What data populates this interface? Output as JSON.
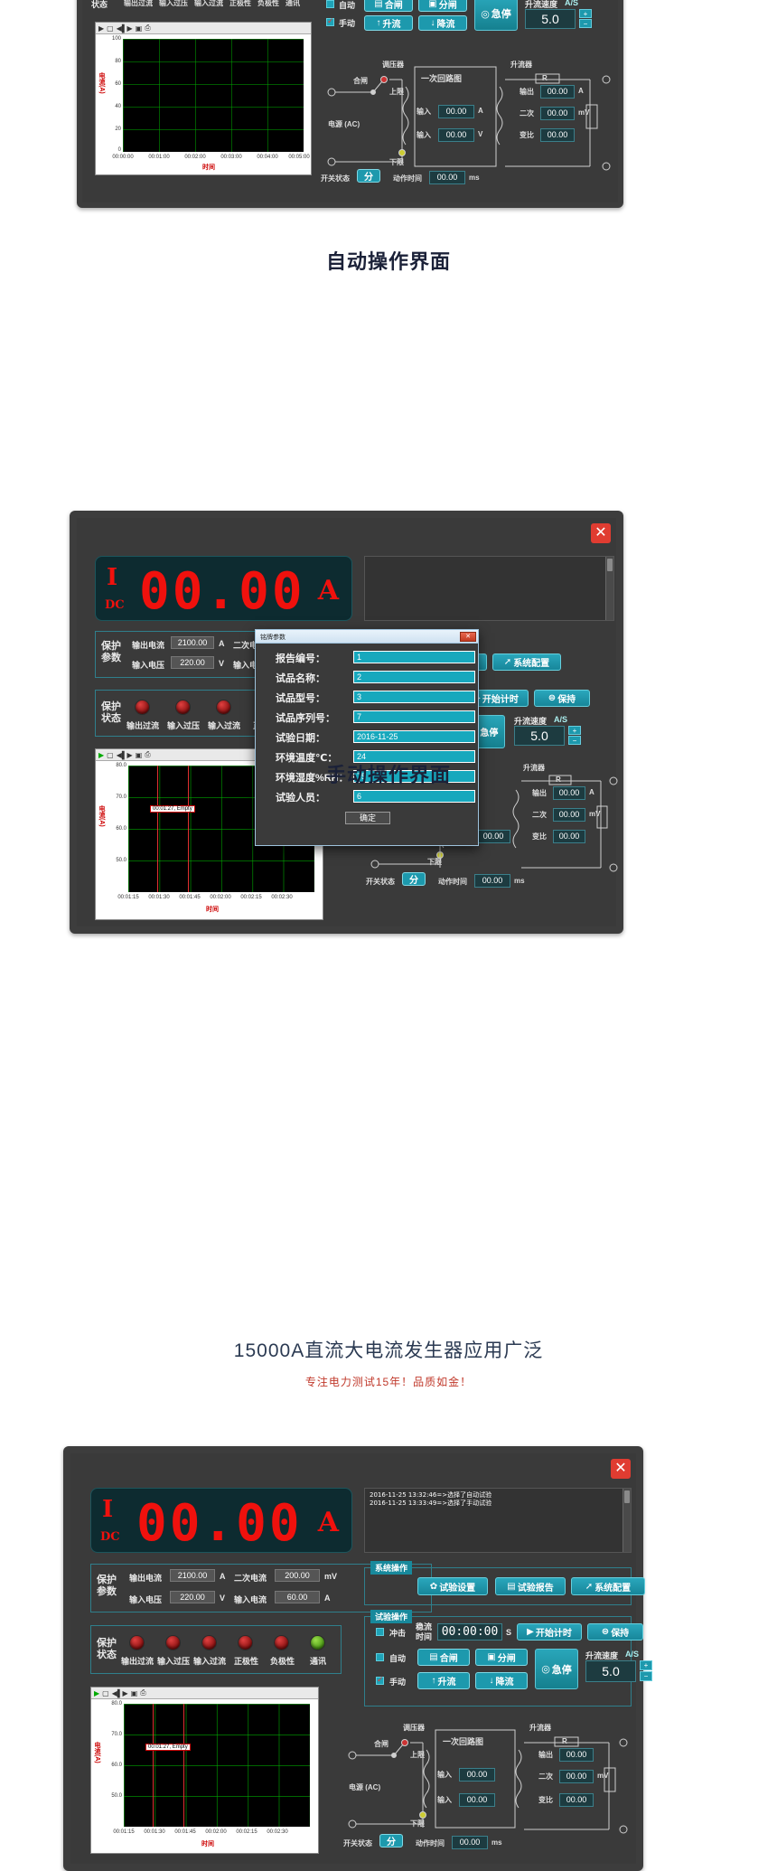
{
  "sections": {
    "auto_title": "自动操作界面",
    "manual_title": "手动操作界面"
  },
  "footer": {
    "title": "15000A直流大电流发生器应用广泛",
    "subtitle": "专注电力测试15年！品质如金！"
  },
  "common": {
    "close_label": "✕",
    "led": {
      "i": "I",
      "dc": "DC",
      "digits": "00.00",
      "unit": "A"
    },
    "protect_params": {
      "title_line1": "保护",
      "title_line2": "参数",
      "out_current_label": "输出电流",
      "out_current_value": "2100.00",
      "out_current_unit": "A",
      "sec_current_label": "二次电流",
      "sec_current_value": "200.00",
      "sec_current_unit": "mV",
      "in_voltage_label": "输入电压",
      "in_voltage_value": "220.00",
      "in_voltage_unit": "V",
      "in_current_label": "输入电流",
      "in_current_value": "60.00",
      "in_current_unit": "A"
    },
    "protect_status": {
      "title_line1": "保护",
      "title_line2": "状态",
      "items": [
        {
          "label": "输出过流",
          "color": "red"
        },
        {
          "label": "输入过压",
          "color": "red"
        },
        {
          "label": "输入过流",
          "color": "red"
        },
        {
          "label": "正极性",
          "color": "red"
        },
        {
          "label": "负极性",
          "color": "red"
        },
        {
          "label": "通讯",
          "color": "green"
        }
      ]
    },
    "system_ops": {
      "group_label": "系统操作",
      "buttons": [
        {
          "icon": "gear-icon",
          "glyph": "✿",
          "label": "试验设置"
        },
        {
          "icon": "report-icon",
          "glyph": "▤",
          "label": "试验报告"
        },
        {
          "icon": "wrench-icon",
          "glyph": "➚",
          "label": "系统配置"
        }
      ]
    },
    "test_ops": {
      "group_label": "试验操作",
      "impulse_label": "冲击",
      "steady_label_l1": "稳流",
      "steady_label_l2": "时间",
      "timer_value": "00:00:00",
      "timer_unit": "S",
      "start_timer_label": "开始计时",
      "hold_label": "保持",
      "auto_label": "自动",
      "manual_label": "手动",
      "close_switch_label": "合闸",
      "open_switch_label": "分闸",
      "raise_label": "升流",
      "lower_label": "降流",
      "estop_label": "急停",
      "rate_label": "升流速度",
      "rate_unit": "A/S",
      "rate_value": "5.0"
    },
    "circuit": {
      "regulator": "调压器",
      "booster": "升流器",
      "close": "合闸",
      "upper": "上限",
      "lower": "下限",
      "primary_loop": "一次回路图",
      "power_ac": "电源 (AC)",
      "input1_label": "输入",
      "input1_value": "00.00",
      "input1_unit": "A",
      "input2_label": "输入",
      "input2_value": "00.00",
      "input2_unit": "V",
      "out_label": "输出",
      "out_value": "00.00",
      "out_unit": "A",
      "sec_label": "二次",
      "sec_value": "00.00",
      "sec_unit": "mV",
      "ratio_label": "变比",
      "ratio_value": "00.00",
      "resistor": "R",
      "switch_state_label": "开关状态",
      "switch_state_value": "分",
      "action_time_label": "动作时间",
      "action_time_value": "00.00",
      "action_time_unit": "ms"
    },
    "chart_toolbar_icons": [
      "play-icon",
      "stop-icon",
      "step-icon",
      "save-icon",
      "print-icon"
    ]
  },
  "top_panel": {
    "status_header": "状态",
    "status_labels": [
      "输出过流",
      "输入过压",
      "输入过流",
      "正极性",
      "负极性",
      "通讯"
    ]
  },
  "auto_panel": {
    "log_lines": []
  },
  "manual_panel": {
    "log_lines": [
      "2016-11-25 13:32:46=>选择了自动试验",
      "2016-11-25 13:33:49=>选择了手动试验"
    ]
  },
  "dialog": {
    "title": "铭牌参数",
    "close_label": "✕",
    "ok_label": "确定",
    "fields": [
      {
        "label": "报告编号：",
        "value": "1"
      },
      {
        "label": "试品名称：",
        "value": "2"
      },
      {
        "label": "试品型号：",
        "value": "3"
      },
      {
        "label": "试品序列号：",
        "value": "7"
      },
      {
        "label": "试验日期：",
        "value": "2016-11-25"
      },
      {
        "label": "环境温度℃：",
        "value": "24"
      },
      {
        "label": "环境湿度%RH：",
        "value": "75"
      },
      {
        "label": "试验人员：",
        "value": "6"
      }
    ]
  },
  "chart_data": [
    {
      "id": "top-chart",
      "type": "line",
      "title": "",
      "xlabel": "时间",
      "ylabel": "电流(A)",
      "ylim": [
        0,
        100
      ],
      "yticks": [
        "100",
        "80",
        "60",
        "40",
        "20",
        "0"
      ],
      "xticks": [
        "00:00:00",
        "00:01:00",
        "00:02:00",
        "00:03:00",
        "00:04:00",
        "00:05:00"
      ],
      "grid": true,
      "series": [
        {
          "name": "电流",
          "values": []
        }
      ]
    },
    {
      "id": "auto-chart",
      "type": "line",
      "title": "",
      "xlabel": "时间",
      "ylabel": "电流(A)",
      "ylim": [
        50,
        80
      ],
      "yticks": [
        "80.0",
        "70.0",
        "60.0",
        "50.0"
      ],
      "xticks": [
        "00:01:15",
        "00:01:30",
        "00:01:45",
        "00:02:00",
        "00:02:15",
        "00:02:30"
      ],
      "grid": true,
      "annotation": "00:01:27, Empty",
      "series": [
        {
          "name": "电流",
          "values": []
        }
      ]
    },
    {
      "id": "manual-chart",
      "type": "line",
      "title": "",
      "xlabel": "时间",
      "ylabel": "电流(A)",
      "ylim": [
        50,
        80
      ],
      "yticks": [
        "80.0",
        "70.0",
        "60.0",
        "50.0"
      ],
      "xticks": [
        "00:01:15",
        "00:01:30",
        "00:01:45",
        "00:02:00",
        "00:02:15",
        "00:02:30"
      ],
      "grid": true,
      "annotation": "00:01:27, Empty",
      "series": [
        {
          "name": "电流",
          "values": []
        }
      ]
    }
  ]
}
